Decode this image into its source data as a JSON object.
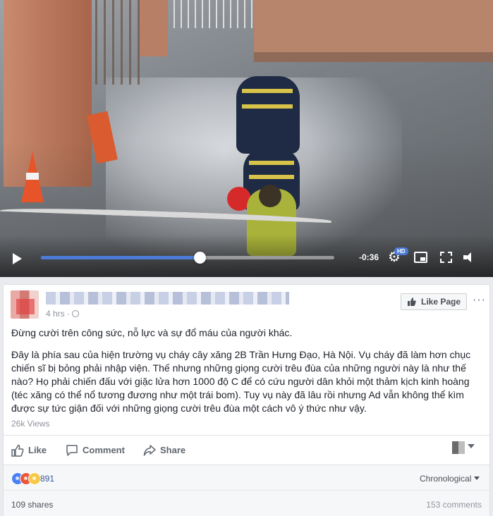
{
  "video": {
    "time_remaining": "-0:36",
    "hd_badge": "HD",
    "progress_fraction": 0.54
  },
  "post": {
    "posted_time": "4 hrs",
    "like_page_label": "Like Page",
    "more_label": "···",
    "paragraphs": [
      "Đừng cười trên công sức, nỗ lực và sự đổ máu của người khác.",
      "Đây là phía sau của hiện trường vụ cháy cây xăng 2B Trần Hưng Đạo, Hà Nội. Vụ cháy đã làm hơn chục chiến sĩ bị bỏng phải nhập viện. Thế nhưng những giọng cười trêu đùa của những người này là như thế nào? Họ phải chiến đấu với giặc lửa hơn 1000 độ C để có cứu người dân khỏi một thảm kịch kinh hoàng (téc xăng có thể nổ tương đương như một trái bom). Tuy vụ này đã lâu rồi nhưng Ad vẫn không thể kìm được sự tức giận đối với những giọng cười trêu đùa một cách vô ý thức như vậy."
    ],
    "views": "26k Views"
  },
  "actions": {
    "like": "Like",
    "comment": "Comment",
    "share": "Share"
  },
  "reactions": {
    "count": "891",
    "sort": "Chronological"
  },
  "footer": {
    "shares": "109 shares",
    "comments": "153 comments"
  },
  "colors": {
    "accent": "#4b7bd6",
    "link": "#365899",
    "muted": "#90949c"
  }
}
